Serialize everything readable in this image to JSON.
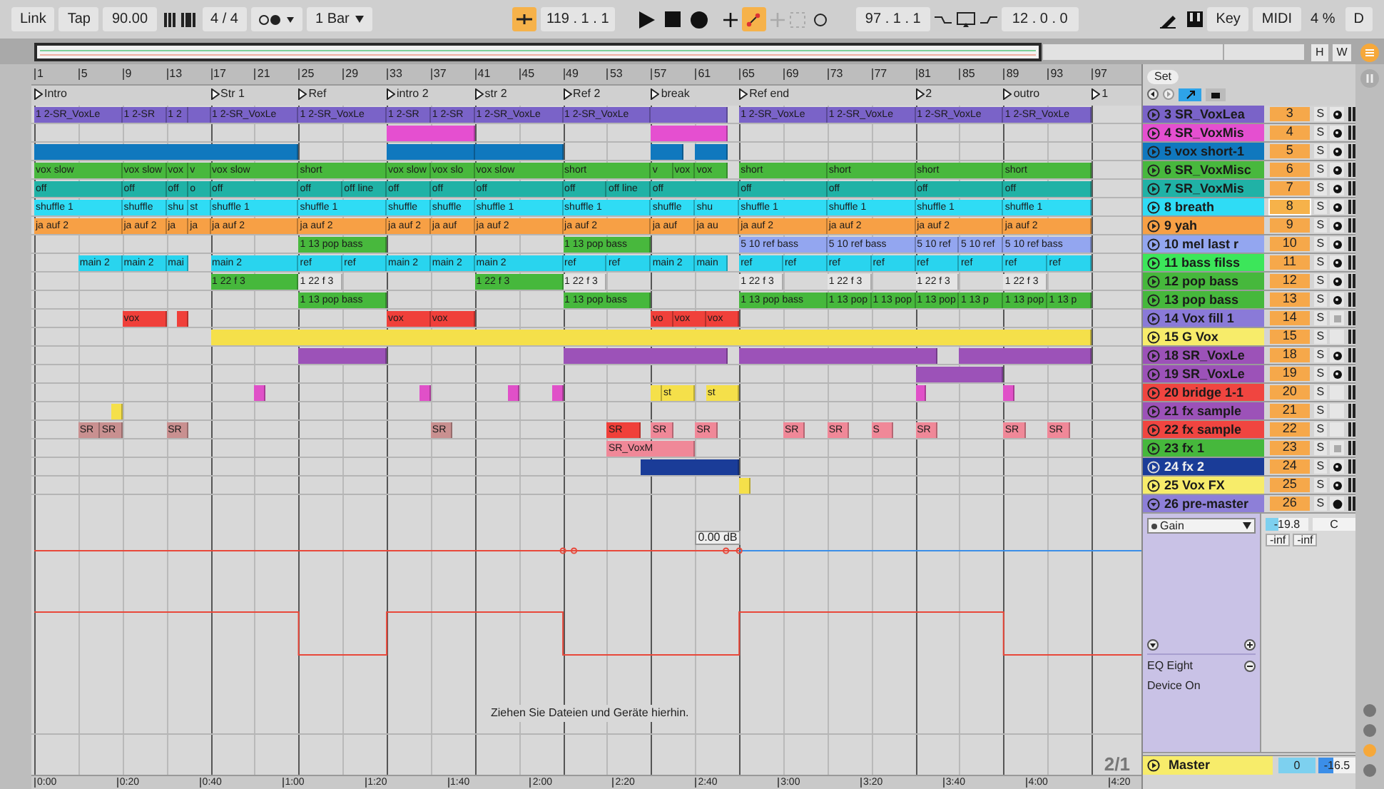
{
  "toolbar": {
    "link": "Link",
    "tap": "Tap",
    "tempo": "90.00",
    "signature": "4 / 4",
    "quantize": "1 Bar",
    "position": "119 .  1 .  1",
    "loop_start": "97 .  1 .  1",
    "loop_length": "12 .  0 .  0",
    "key": "Key",
    "midi": "MIDI",
    "cpu": "4 %",
    "disk": "D"
  },
  "overview": {
    "buttons": [
      "H",
      "W"
    ]
  },
  "ruler": [
    "1",
    "5",
    "9",
    "13",
    "17",
    "21",
    "25",
    "29",
    "33",
    "37",
    "41",
    "45",
    "49",
    "53",
    "57",
    "61",
    "65",
    "69",
    "73",
    "77",
    "81",
    "85",
    "89",
    "93",
    "97"
  ],
  "locators": [
    "Intro",
    "Str 1",
    "Ref",
    "intro 2",
    "str 2",
    "Ref 2",
    "break",
    "Ref end",
    "2",
    "outro",
    "1"
  ],
  "set_button": "Set",
  "tracks": [
    {
      "name": "3 SR_VoxLea",
      "number": "3",
      "solo": "S",
      "color": "#7a63c8",
      "selected": false,
      "kind": "dot",
      "clips": [
        {
          "name": "1 2-SR_VoxLe",
          "color": "#7a63c8"
        },
        {
          "name": "1 2-SR",
          "color": "#7a63c8"
        },
        {
          "name": "1 2",
          "color": "#7a63c8"
        },
        {
          "color": "#7a63c8"
        },
        {
          "name": "1 2-SR_VoxLe",
          "color": "#7a63c8"
        },
        {
          "name": "1 2-SR_VoxLe",
          "color": "#7a63c8"
        },
        {
          "name": "1 2-SR",
          "color": "#7a63c8"
        },
        {
          "name": "1 2-SR",
          "color": "#7a63c8"
        },
        {
          "name": "1 2-SR_VoxLe",
          "color": "#7a63c8"
        },
        {
          "name": "1 2-SR_VoxLe",
          "color": "#7a63c8"
        },
        {
          "color": "#7a63c8"
        },
        {
          "name": "1 2-SR_VoxLe",
          "color": "#7a63c8"
        },
        {
          "name": "1 2-SR_VoxLe",
          "color": "#7a63c8"
        },
        {
          "name": "1 2-SR_VoxLe",
          "color": "#7a63c8"
        },
        {
          "name": "1 2-SR_VoxLe",
          "color": "#7a63c8"
        }
      ]
    },
    {
      "name": "4 SR_VoxMis",
      "number": "4",
      "solo": "S",
      "color": "#e54fd0",
      "selected": false,
      "kind": "dot",
      "clips": [
        {
          "color": "#e54fd0"
        },
        {
          "color": "#e54fd0"
        }
      ]
    },
    {
      "name": "5 vox short-1",
      "number": "5",
      "solo": "S",
      "color": "#1078be",
      "selected": false,
      "kind": "dot",
      "clips": [
        {
          "color": "#1078be"
        },
        {
          "color": "#1078be"
        },
        {
          "color": "#1078be"
        },
        {
          "color": "#1078be"
        },
        {
          "color": "#1078be"
        }
      ]
    },
    {
      "name": "6 SR_VoxMisc",
      "number": "6",
      "solo": "S",
      "color": "#48b83d",
      "selected": false,
      "kind": "dot",
      "clips": [
        {
          "name": "vox slow",
          "color": "#48b83d"
        },
        {
          "name": "vox slow",
          "color": "#48b83d"
        },
        {
          "name": "vox",
          "color": "#48b83d"
        },
        {
          "name": "v",
          "color": "#48b83d"
        },
        {
          "name": "vox slow",
          "color": "#48b83d"
        },
        {
          "name": "short",
          "color": "#48b83d"
        },
        {
          "name": "vox slow",
          "color": "#48b83d"
        },
        {
          "name": "vox slo",
          "color": "#48b83d"
        },
        {
          "name": "vox slow",
          "color": "#48b83d"
        },
        {
          "name": "short",
          "color": "#48b83d"
        },
        {
          "name": "v",
          "color": "#48b83d"
        },
        {
          "name": "vox",
          "color": "#48b83d"
        },
        {
          "name": "vox",
          "color": "#48b83d"
        },
        {
          "name": "short",
          "color": "#48b83d"
        },
        {
          "name": "short",
          "color": "#48b83d"
        },
        {
          "name": "short",
          "color": "#48b83d"
        },
        {
          "name": "short",
          "color": "#48b83d"
        }
      ]
    },
    {
      "name": "7 SR_VoxMis",
      "number": "7",
      "solo": "S",
      "color": "#20b2a6",
      "selected": false,
      "kind": "dot",
      "clips": [
        {
          "name": "off",
          "color": "#20b2a6"
        },
        {
          "name": "off",
          "color": "#20b2a6"
        },
        {
          "name": "off",
          "color": "#20b2a6"
        },
        {
          "name": "o",
          "color": "#20b2a6"
        },
        {
          "name": "off",
          "color": "#20b2a6"
        },
        {
          "name": "off",
          "color": "#20b2a6"
        },
        {
          "name": "off line",
          "color": "#20b2a6"
        },
        {
          "name": "off",
          "color": "#20b2a6"
        },
        {
          "name": "off",
          "color": "#20b2a6"
        },
        {
          "name": "off",
          "color": "#20b2a6"
        },
        {
          "name": "off",
          "color": "#20b2a6"
        },
        {
          "name": "off line",
          "color": "#20b2a6"
        },
        {
          "name": "off",
          "color": "#20b2a6"
        },
        {
          "name": "off",
          "color": "#20b2a6"
        },
        {
          "name": "off",
          "color": "#20b2a6"
        },
        {
          "name": "off",
          "color": "#20b2a6"
        },
        {
          "name": "off",
          "color": "#20b2a6"
        }
      ]
    },
    {
      "name": "8 breath",
      "number": "8",
      "solo": "S",
      "color": "#2fdcf5",
      "selected": true,
      "kind": "dot",
      "clips": [
        {
          "name": "shuffle 1",
          "color": "#2fdcf5"
        },
        {
          "name": "shuffle",
          "color": "#2fdcf5"
        },
        {
          "name": "shu",
          "color": "#2fdcf5"
        },
        {
          "name": "st",
          "color": "#2fdcf5"
        },
        {
          "name": "shuffle 1",
          "color": "#2fdcf5"
        },
        {
          "name": "shuffle 1",
          "color": "#2fdcf5"
        },
        {
          "name": "shuffle",
          "color": "#2fdcf5"
        },
        {
          "name": "shuffle",
          "color": "#2fdcf5"
        },
        {
          "name": "shuffle 1",
          "color": "#2fdcf5"
        },
        {
          "name": "shuffle 1",
          "color": "#2fdcf5"
        },
        {
          "name": "shuffle",
          "color": "#2fdcf5"
        },
        {
          "name": "shu",
          "color": "#2fdcf5"
        },
        {
          "name": "shuffle 1",
          "color": "#2fdcf5"
        },
        {
          "name": "shuffle 1",
          "color": "#2fdcf5"
        },
        {
          "name": "shuffle 1",
          "color": "#2fdcf5"
        },
        {
          "name": "shuffle 1",
          "color": "#2fdcf5"
        }
      ]
    },
    {
      "name": "9 yah",
      "number": "9",
      "solo": "S",
      "color": "#f7a045",
      "selected": false,
      "kind": "dot",
      "clips": [
        {
          "name": "ja auf 2",
          "color": "#f7a045"
        },
        {
          "name": "ja auf 2",
          "color": "#f7a045"
        },
        {
          "name": "ja",
          "color": "#f7a045"
        },
        {
          "name": "ja",
          "color": "#f7a045"
        },
        {
          "name": "ja auf 2",
          "color": "#f7a045"
        },
        {
          "name": "ja auf 2",
          "color": "#f7a045"
        },
        {
          "name": "ja auf 2",
          "color": "#f7a045"
        },
        {
          "name": "ja auf",
          "color": "#f7a045"
        },
        {
          "name": "ja auf 2",
          "color": "#f7a045"
        },
        {
          "name": "ja auf 2",
          "color": "#f7a045"
        },
        {
          "name": "ja auf",
          "color": "#f7a045"
        },
        {
          "name": "ja au",
          "color": "#f7a045"
        },
        {
          "name": "ja auf 2",
          "color": "#f7a045"
        },
        {
          "name": "ja auf 2",
          "color": "#f7a045"
        },
        {
          "name": "ja auf 2",
          "color": "#f7a045"
        },
        {
          "name": "ja auf 2",
          "color": "#f7a045"
        }
      ]
    },
    {
      "name": "10 mel last r",
      "number": "10",
      "solo": "S",
      "color": "#93a6f0",
      "selected": false,
      "kind": "dot",
      "clips": [
        {
          "name": "1 13 pop bass",
          "color": "#48b83d"
        },
        {
          "name": "1 13 pop bass",
          "color": "#48b83d"
        },
        {
          "name": "5 10 ref bass",
          "color": "#93a6f0"
        },
        {
          "name": "5 10 ref bass",
          "color": "#93a6f0"
        },
        {
          "name": "5 10 ref",
          "color": "#93a6f0"
        },
        {
          "name": "5 10 ref",
          "color": "#93a6f0"
        },
        {
          "name": "5 10 ref bass",
          "color": "#93a6f0"
        }
      ]
    },
    {
      "name": "11 bass filss",
      "number": "11",
      "solo": "S",
      "color": "#3ce65a",
      "selected": false,
      "kind": "dot",
      "clips": [
        {
          "name": "main 2",
          "color": "#29d4ee"
        },
        {
          "name": "main 2",
          "color": "#29d4ee"
        },
        {
          "name": "mai",
          "color": "#29d4ee"
        },
        {
          "name": "main 2",
          "color": "#29d4ee"
        },
        {
          "name": "ref",
          "color": "#29d4ee"
        },
        {
          "name": "ref",
          "color": "#29d4ee"
        },
        {
          "name": "main 2",
          "color": "#29d4ee"
        },
        {
          "name": "main 2",
          "color": "#29d4ee"
        },
        {
          "name": "main 2",
          "color": "#29d4ee"
        },
        {
          "name": "ref",
          "color": "#29d4ee"
        },
        {
          "name": "ref",
          "color": "#29d4ee"
        },
        {
          "name": "main 2",
          "color": "#29d4ee"
        },
        {
          "name": "main",
          "color": "#29d4ee"
        },
        {
          "name": "ref",
          "color": "#29d4ee"
        },
        {
          "name": "ref",
          "color": "#29d4ee"
        },
        {
          "name": "ref",
          "color": "#29d4ee"
        },
        {
          "name": "ref",
          "color": "#29d4ee"
        },
        {
          "name": "ref",
          "color": "#29d4ee"
        },
        {
          "name": "ref",
          "color": "#29d4ee"
        },
        {
          "name": "ref",
          "color": "#29d4ee"
        },
        {
          "name": "ref",
          "color": "#29d4ee"
        }
      ]
    },
    {
      "name": "12 pop bass",
      "number": "12",
      "solo": "S",
      "color": "#46b83c",
      "selected": false,
      "kind": "dot",
      "clips": [
        {
          "name": "1 22 f 3",
          "color": "#46b83c"
        },
        {
          "name": "1 22 f 3",
          "color": "#e4e4e4"
        },
        {
          "name": "1 22 f 3",
          "color": "#46b83c"
        },
        {
          "name": "1 22 f 3",
          "color": "#e4e4e4"
        },
        {
          "name": "1 22 f 3",
          "color": "#e4e4e4"
        },
        {
          "name": "1 22 f 3",
          "color": "#e4e4e4"
        },
        {
          "name": "1 22 f 3",
          "color": "#e4e4e4"
        },
        {
          "name": "1 22 f 3",
          "color": "#e4e4e4"
        }
      ]
    },
    {
      "name": "13 pop bass",
      "number": "13",
      "solo": "S",
      "color": "#46b83c",
      "selected": false,
      "kind": "dot",
      "clips": [
        {
          "name": "1 13 pop bass",
          "color": "#46b83c"
        },
        {
          "name": "1 13 pop bass",
          "color": "#46b83c"
        },
        {
          "name": "1 13 pop bass",
          "color": "#46b83c"
        },
        {
          "name": "1 13 pop",
          "color": "#46b83c"
        },
        {
          "name": "1 13 pop",
          "color": "#46b83c"
        },
        {
          "name": "1 13 pop",
          "color": "#46b83c"
        },
        {
          "name": "1 13 p",
          "color": "#46b83c"
        },
        {
          "name": "1 13 pop",
          "color": "#46b83c"
        },
        {
          "name": "1 13 p",
          "color": "#46b83c"
        }
      ]
    },
    {
      "name": "14 Vox fill 1",
      "number": "14",
      "solo": "S",
      "color": "#8a7ad8",
      "selected": false,
      "kind": "square",
      "clips": [
        {
          "name": "vox",
          "color": "#f0403a"
        },
        {
          "color": "#f0403a"
        },
        {
          "name": "vox",
          "color": "#f0403a"
        },
        {
          "name": "vox",
          "color": "#f0403a"
        },
        {
          "name": "vo",
          "color": "#f0403a"
        },
        {
          "name": "vox",
          "color": "#f0403a"
        },
        {
          "name": "vox",
          "color": "#f0403a"
        }
      ]
    },
    {
      "name": "15 G Vox",
      "number": "15",
      "solo": "S",
      "color": "#f7ec6a",
      "selected": false,
      "kind": "plain",
      "clips": [
        {
          "color": "#f5e04a"
        }
      ]
    },
    {
      "name": "18 SR_VoxLe",
      "number": "18",
      "solo": "S",
      "color": "#9c52b8",
      "selected": false,
      "kind": "dot",
      "clips": [
        {
          "color": "#9c52b8"
        },
        {
          "color": "#9c52b8"
        },
        {
          "color": "#9c52b8"
        },
        {
          "color": "#9c52b8"
        }
      ]
    },
    {
      "name": "19 SR_VoxLe",
      "number": "19",
      "solo": "S",
      "color": "#9c52b8",
      "selected": false,
      "kind": "dot",
      "clips": [
        {
          "color": "#9c52b8"
        }
      ]
    },
    {
      "name": "20 bridge 1-1",
      "number": "20",
      "solo": "S",
      "color": "#f04540",
      "selected": false,
      "kind": "plain",
      "clips": [
        {
          "color": "#e050c8"
        },
        {
          "color": "#e050c8"
        },
        {
          "color": "#e050c8"
        },
        {
          "color": "#e050c8"
        },
        {
          "color": "#f5e04a"
        },
        {
          "name": "st",
          "color": "#f5e04a"
        },
        {
          "name": "st",
          "color": "#f5e04a"
        },
        {
          "color": "#e050c8"
        },
        {
          "color": "#e050c8"
        }
      ]
    },
    {
      "name": "21 fx sample",
      "number": "21",
      "solo": "S",
      "color": "#9c52b8",
      "selected": false,
      "kind": "plain",
      "clips": [
        {
          "color": "#f5e04a"
        }
      ]
    },
    {
      "name": "22 fx sample",
      "number": "22",
      "solo": "S",
      "color": "#f04540",
      "selected": false,
      "kind": "plain",
      "clips": [
        {
          "name": "SR",
          "color": "#c99090"
        },
        {
          "name": "SR",
          "color": "#c99090"
        },
        {
          "name": "SR",
          "color": "#c99090"
        },
        {
          "name": "SR",
          "color": "#c99090"
        },
        {
          "name": "SR",
          "color": "#f0403a"
        },
        {
          "name": "SR",
          "color": "#f08898"
        },
        {
          "name": "SR",
          "color": "#f08898"
        },
        {
          "name": "SR",
          "color": "#f08898"
        },
        {
          "name": "SR",
          "color": "#f08898"
        },
        {
          "name": "S",
          "color": "#f08898"
        },
        {
          "name": "SR",
          "color": "#f08898"
        },
        {
          "name": "SR",
          "color": "#f08898"
        },
        {
          "name": "SR",
          "color": "#f08898"
        }
      ]
    },
    {
      "name": "23 fx 1",
      "number": "23",
      "solo": "S",
      "color": "#46b83c",
      "selected": false,
      "kind": "square",
      "clips": [
        {
          "name": "SR_VoxM",
          "color": "#f08898"
        }
      ]
    },
    {
      "name": "24 fx 2",
      "number": "24",
      "solo": "S",
      "color": "#1a3c98",
      "selected": false,
      "kind": "dot",
      "clips": [
        {
          "color": "#1a3c98"
        }
      ]
    },
    {
      "name": "25 Vox FX",
      "number": "25",
      "solo": "S",
      "color": "#f7ec6a",
      "selected": false,
      "kind": "dot",
      "clips": [
        {
          "color": "#f5e04a"
        }
      ]
    },
    {
      "name": "26 pre-master",
      "number": "26",
      "solo": "S",
      "color": "#8d7fd8",
      "selected": false,
      "kind": "filled",
      "expanded": true,
      "parameter": "Gain",
      "volume": "-19.8",
      "pan": "C",
      "peaks": [
        "-inf",
        "-inf"
      ],
      "device": "EQ Eight",
      "device_parameter": "Device On",
      "automation_value": "0.00 dB"
    }
  ],
  "drop_hint": "Ziehen Sie Dateien und Geräte hierhin.",
  "master": {
    "name": "Master",
    "volume": "0",
    "level_reading": "-16.5"
  },
  "zoom_label": "2/1",
  "time_ruler": [
    "0:00",
    "0:20",
    "0:40",
    "1:00",
    "1:20",
    "1:40",
    "2:00",
    "2:20",
    "2:40",
    "3:00",
    "3:20",
    "3:40",
    "4:00",
    "4:20"
  ]
}
